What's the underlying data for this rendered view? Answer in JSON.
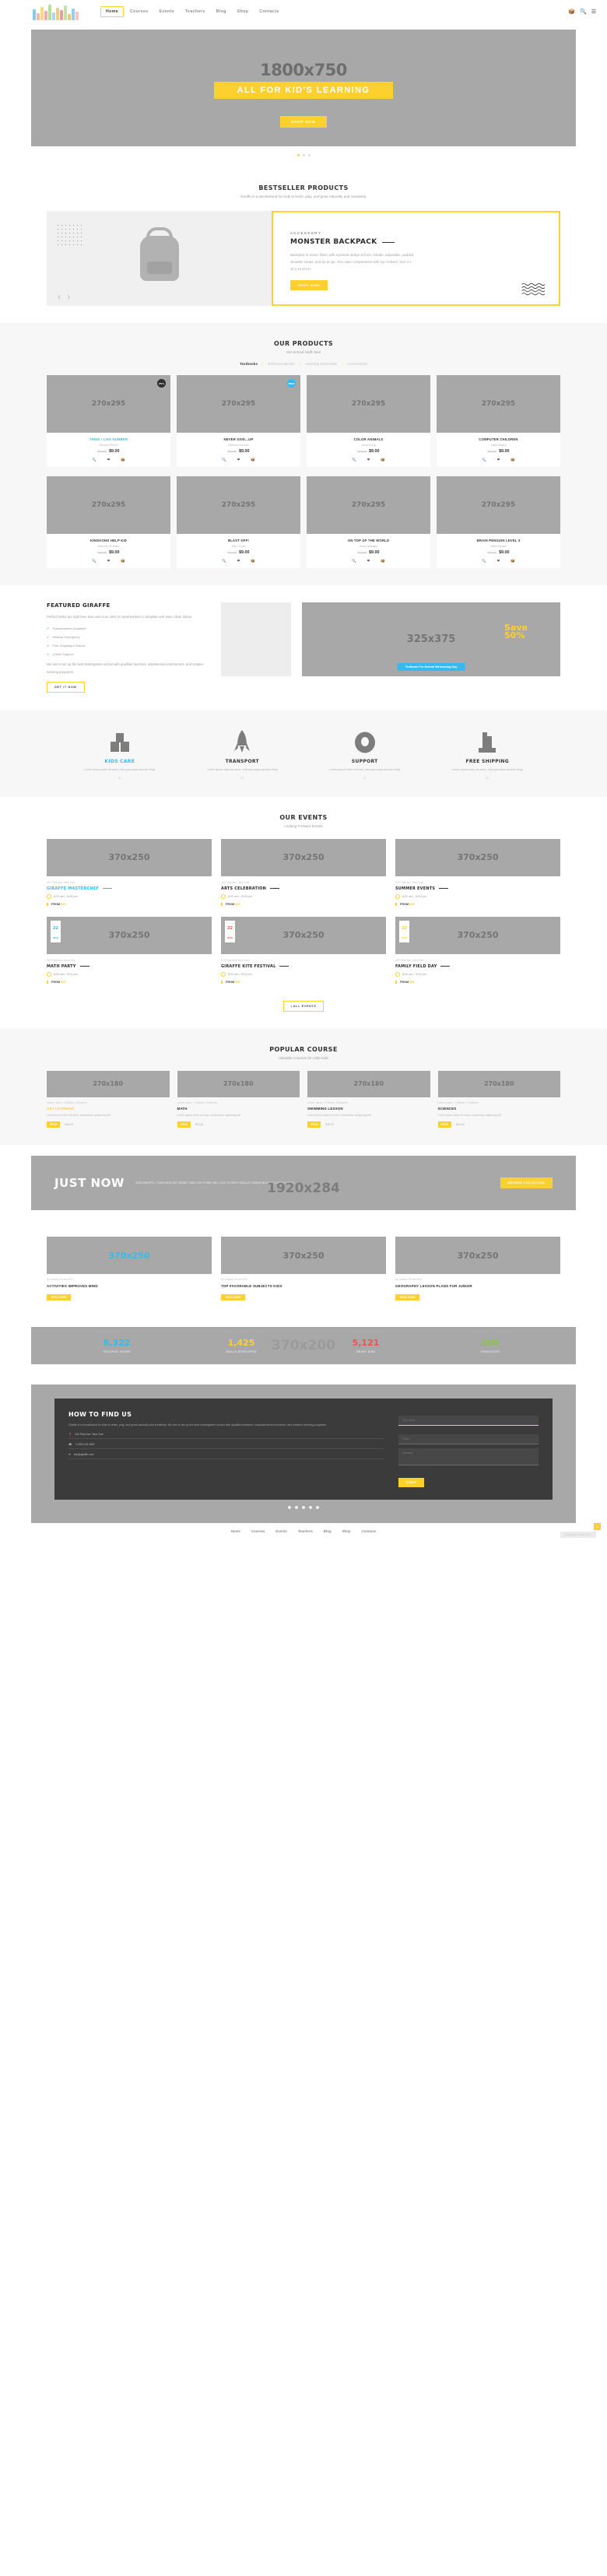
{
  "header": {
    "nav": [
      {
        "label": "Home",
        "active": true
      },
      {
        "label": "Courses",
        "active": false
      },
      {
        "label": "Events",
        "active": false
      },
      {
        "label": "Teachers",
        "active": false
      },
      {
        "label": "Blog",
        "active": false
      },
      {
        "label": "Shop",
        "active": false
      },
      {
        "label": "Contacts",
        "active": false
      }
    ],
    "icons": [
      "cart-icon",
      "search-icon",
      "menu-icon"
    ],
    "logo_colors": [
      "#6ec6e8",
      "#f4a9a9",
      "#f7d26a",
      "#f29b9b",
      "#a8d88f",
      "#9ad0ea",
      "#f5c26b",
      "#eb8a8a",
      "#b8dca0",
      "#f0c05a",
      "#7fc9e8",
      "#f5b8b8"
    ]
  },
  "hero": {
    "placeholder": "1800x750",
    "headline": "ALL FOR KID'S LEARNING",
    "button": "SHOP NOW",
    "dots": 3,
    "active_dot": 0
  },
  "bestseller": {
    "title": "BESTSELLER PRODUCTS",
    "subtitle": "Giraffe is a wonderland for Kids to learn, play, and grow naturally and creatively.",
    "eyebrow": "ACCESSORY",
    "product_name": "MONSTER BACKPACK",
    "description": "Backpack in woven fabric with a printed design at front. Handle, adjustable, padded shoulder straps, and zip at top. One outer compartment with zip. Unlined. Size 4 x 10 x 13 3/4 in.",
    "button": "SHOP NOW"
  },
  "products": {
    "title": "OUR PRODUCTS",
    "subtitle": "Get School Stuff Here",
    "tabs": [
      {
        "label": "Textbooks",
        "active": true
      },
      {
        "label": "ReferenceBooks",
        "active": false
      },
      {
        "label": "Learning Essentials",
        "active": false
      },
      {
        "label": "Accessories",
        "active": false
      }
    ],
    "placeholder": "270x295",
    "items": [
      {
        "name": "THINK I LIKE NUMBER",
        "author": "Richard Perez",
        "old_price": "$15.00",
        "price": "$9.00",
        "badge": "25%",
        "badge_type": "dark",
        "highlight": true
      },
      {
        "name": "NEVER GIVE...UP",
        "author": "Micheal Doodle",
        "old_price": "$15.00",
        "price": "$9.00",
        "badge": "NEW",
        "badge_type": "blue",
        "highlight": false
      },
      {
        "name": "COLOR ANIMALS",
        "author": "Grap Kong",
        "old_price": "$15.00",
        "price": "$9.00",
        "badge": "",
        "badge_type": "",
        "highlight": false
      },
      {
        "name": "COMPUTER CHILDREN",
        "author": "Zata Magini",
        "old_price": "$15.00",
        "price": "$9.00",
        "badge": "",
        "badge_type": "",
        "highlight": false
      },
      {
        "name": "KINGKONG HELP KID",
        "author": "Hannah Showler",
        "old_price": "$15.00",
        "price": "$9.00",
        "badge": "",
        "badge_type": "",
        "highlight": false
      },
      {
        "name": "BLAST OFF!",
        "author": "Tom Crush",
        "old_price": "$15.00",
        "price": "$9.00",
        "badge": "",
        "badge_type": "",
        "highlight": false
      },
      {
        "name": "ON TOP OF THE WORLD",
        "author": "Anna Makitah",
        "old_price": "$15.00",
        "price": "$9.00",
        "badge": "",
        "badge_type": "",
        "highlight": false
      },
      {
        "name": "BRAIN PENGUIN LEVEL 3",
        "author": "Miki Kanata",
        "old_price": "$15.00",
        "price": "$9.00",
        "badge": "",
        "badge_type": "",
        "highlight": false
      }
    ],
    "icons": [
      "zoom-icon",
      "heart-icon",
      "cart-icon"
    ]
  },
  "featured": {
    "title": "FEATURED GIRAFFE",
    "paragraph": "Perfect books are right here duis aute irure dolor in reprehenderit in voluptate velit esse cillum dolore.",
    "list": [
      "Transportation Available.",
      "Medical Emergency.",
      "Free Shipping & Return.",
      "Online Support."
    ],
    "paragraph2": "We aim to set up the best kindergarten school with qualified teachers, inspirational environment, and creative learning programs.",
    "button": "GET IT NOW",
    "promo_placeholder": "325x375",
    "save_line1": "Save",
    "save_line2": "50%",
    "promo_tag": "Textbook For School Welcoming Day"
  },
  "services": [
    {
      "icon": "kids-care-icon",
      "title": "KIDS CARE",
      "text": "Lorem ipsum dolor sit amet, velit quis turpis aenean fringi",
      "num": "01",
      "highlight": true
    },
    {
      "icon": "rocket-icon",
      "title": "TRANSPORT",
      "text": "Lorem ipsum dolor sit amet, velit quis turpis aenean fringi",
      "num": "02",
      "highlight": false
    },
    {
      "icon": "support-ring-icon",
      "title": "SUPPORT",
      "text": "Lorem ipsum dolor sit amet, velit quis turpis aenean fringi",
      "num": "03",
      "highlight": false
    },
    {
      "icon": "building-icon",
      "title": "FREE SHIPPING",
      "text": "Lorem ipsum dolor sit amet, velit quis turpis aenean fringi",
      "num": "04",
      "highlight": false
    }
  ],
  "events": {
    "title": "OUR EVENTS",
    "subtitle": "Looking Forward Events",
    "placeholder": "370x250",
    "items": [
      {
        "addr": "220 Park Ave, New York",
        "name": "GIRAFFE MASTERCHEF",
        "time": "8:00 am - 5:00 pm",
        "from": "FROM",
        "price": "$59",
        "highlight": true,
        "date_day": "",
        "date_month": "",
        "date_color": ""
      },
      {
        "addr": "220 Park Ave, New York",
        "name": "ARTS CELEBRATION",
        "time": "8:00 am - 5:00 pm",
        "from": "FROM",
        "price": "$59",
        "highlight": false,
        "date_day": "",
        "date_month": "",
        "date_color": ""
      },
      {
        "addr": "220 Park Ave, New York",
        "name": "SUMMER EVENTS",
        "time": "8:00 am - 5:00 pm",
        "from": "FROM",
        "price": "$59",
        "highlight": false,
        "date_day": "",
        "date_month": "",
        "date_color": ""
      },
      {
        "addr": "220 Park Ave, New York",
        "name": "MATH PARTY",
        "time": "8:00 am - 5:00 pm",
        "from": "FROM",
        "price": "$59",
        "highlight": false,
        "date_day": "22",
        "date_month": "AUG",
        "date_color": "#33bbf0"
      },
      {
        "addr": "220 Park Ave, New York",
        "name": "GIRAFFE KITE FESTIVAL",
        "time": "8:00 am - 5:00 pm",
        "from": "FROM",
        "price": "$59",
        "highlight": false,
        "date_day": "22",
        "date_month": "AUG",
        "date_color": "#ef5350"
      },
      {
        "addr": "220 Park Ave, New York",
        "name": "FAMILY FIELD DAY",
        "time": "8:00 am - 5:00 pm",
        "from": "FROM",
        "price": "$59",
        "highlight": false,
        "date_day": "22",
        "date_month": "AUG",
        "date_color": "#fcd02f"
      }
    ],
    "all_button": "| ALL EVENTS"
  },
  "courses": {
    "title": "POPULAR COURSE",
    "subtitle": "Valuable Courses for Little Kids",
    "placeholder": "270x180",
    "items": [
      {
        "meta": "Lorem, Ipsum - 8 Weeks, 4 Students",
        "name": "ART LEARNING",
        "desc": "Lorem ipsum dolor sit amet, consectetur adipiscing elit",
        "from": "FROM",
        "price": "$15.00",
        "highlight": true
      },
      {
        "meta": "Lorem, Ipsum - 8 Weeks, 4 Students",
        "name": "MATH",
        "desc": "Lorem ipsum dolor sit amet, consectetur adipiscing elit",
        "from": "FROM",
        "price": "$15.00",
        "highlight": false
      },
      {
        "meta": "Lorem, Ipsum - 8 Weeks, 4 Students",
        "name": "SWIMMING LESSON",
        "desc": "Lorem ipsum dolor sit amet, consectetur adipiscing elit",
        "from": "FROM",
        "price": "$15.00",
        "highlight": false
      },
      {
        "meta": "Lorem, Ipsum - 8 Weeks, 4 Students",
        "name": "SCIENCES",
        "desc": "Lorem ipsum dolor sit amet, consectetur adipiscing elit",
        "from": "FROM",
        "price": "$15.00",
        "highlight": false
      }
    ]
  },
  "justnow": {
    "title": "JUST NOW",
    "text": "JOIN GIRAFFE, YOUR KIDS GET MORE THAN YOU THINK! WE LOVE TO HELP SMALLS THINGS BECOME LARGE LATER.",
    "button": "BROWSE COLLECTION",
    "placeholder": "1920x284"
  },
  "blog": {
    "placeholder": "370x250",
    "items": [
      {
        "byline": "By Jessica, 25 Jan 2017",
        "title": "ACTIVITIES IMPROVES MIND",
        "more": "READ MORE",
        "highlight": true
      },
      {
        "byline": "By Jessica, 25 Jan 2017",
        "title": "TOP FAVORABLE SUBJECTS KIDS",
        "more": "READ MORE",
        "highlight": false
      },
      {
        "byline": "By Jessica, 25 Jan 2017",
        "title": "GEOGRAPHY LESSON PLANS FOR JUNIOR",
        "more": "READ MORE",
        "highlight": false
      }
    ]
  },
  "stats": {
    "placeholder": "370x200",
    "items": [
      {
        "number": "8,322",
        "label": "TEACHING HOURS",
        "color": "#33bbf0"
      },
      {
        "number": "1,425",
        "label": "SKILLS DEVELOPED",
        "color": "#fcd02f"
      },
      {
        "number": "5,121",
        "label": "SMART KIDS",
        "color": "#ef5350"
      },
      {
        "number": "600",
        "label": "GRADUATES",
        "color": "#8bc34a"
      }
    ]
  },
  "contact": {
    "title": "HOW TO FIND US",
    "paragraph": "Giraffe is a wonderland for Kids to learn, play, and grow naturally and creatively. We aim to set up the best kindergarten school with qualified teachers, inspirational environment, and creative learning programs.",
    "address": "220 Park Ave, New York",
    "phone": "+1 800 123 4567",
    "email": "info@giraffe.com",
    "form": {
      "name_placeholder": "Your name",
      "email_placeholder": "Email",
      "message_placeholder": "Message",
      "submit": "SUBMIT"
    },
    "dots": 5
  },
  "footer": {
    "links": [
      "Home",
      "Courses",
      "Events",
      "Teachers",
      "Blog",
      "Shop",
      "Contacts"
    ],
    "note": "Copyright Giraffe 2017",
    "top_icon": "arrow-up-icon"
  }
}
